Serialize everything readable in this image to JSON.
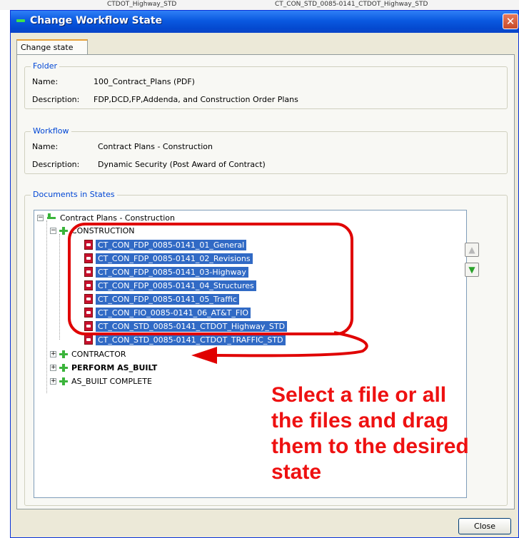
{
  "background": {
    "strip_texts": [
      "CTDOT_Highway_STD",
      "CT_CON_STD_0085-0141_CTDOT_Highway_STD"
    ]
  },
  "dialog": {
    "title": "Change Workflow State",
    "close_glyph": "✕"
  },
  "tabs": [
    {
      "label": "Change state"
    }
  ],
  "folder": {
    "group_label": "Folder",
    "name_label": "Name:",
    "name_value": "100_Contract_Plans (PDF)",
    "description_label": "Description:",
    "description_value": "FDP,DCD,FP,Addenda, and Construction Order Plans"
  },
  "workflow": {
    "group_label": "Workflow",
    "name_label": "Name:",
    "name_value": "Contract Plans - Construction",
    "description_label": "Description:",
    "description_value": "Dynamic Security (Post Award of Contract)"
  },
  "documents": {
    "group_label": "Documents in States",
    "root": {
      "label": "Contract Plans - Construction",
      "expander": "−"
    },
    "construction": {
      "label": "CONSTRUCTION",
      "expander": "−"
    },
    "files": [
      {
        "label": "CT_CON_FDP_0085-0141_01_General"
      },
      {
        "label": "CT_CON_FDP_0085-0141_02_Revisions"
      },
      {
        "label": "CT_CON_FDP_0085-0141_03-Highway"
      },
      {
        "label": "CT_CON_FDP_0085-0141_04_Structures"
      },
      {
        "label": "CT_CON_FDP_0085-0141_05_Traffic"
      },
      {
        "label": "CT_CON_FIO_0085-0141_06_AT&T_FIO"
      },
      {
        "label": "CT_CON_STD_0085-0141_CTDOT_Highway_STD"
      },
      {
        "label": "CT_CON_STD_0085-0141_CTDOT_TRAFFIC_STD"
      }
    ],
    "other_states": [
      {
        "label": "CONTRACTOR",
        "expander": "+",
        "bold": false
      },
      {
        "label": "PERFORM AS_BUILT",
        "expander": "+",
        "bold": true
      },
      {
        "label": "AS_BUILT COMPLETE",
        "expander": "+",
        "bold": false
      }
    ]
  },
  "buttons": {
    "move_up_glyph": "▲",
    "move_down_glyph": "▼",
    "close_label": "Close"
  },
  "annotation": {
    "lines": [
      "Select a file or all",
      "the files and drag",
      "them to the desired",
      "state"
    ],
    "color": "#ee1111"
  }
}
